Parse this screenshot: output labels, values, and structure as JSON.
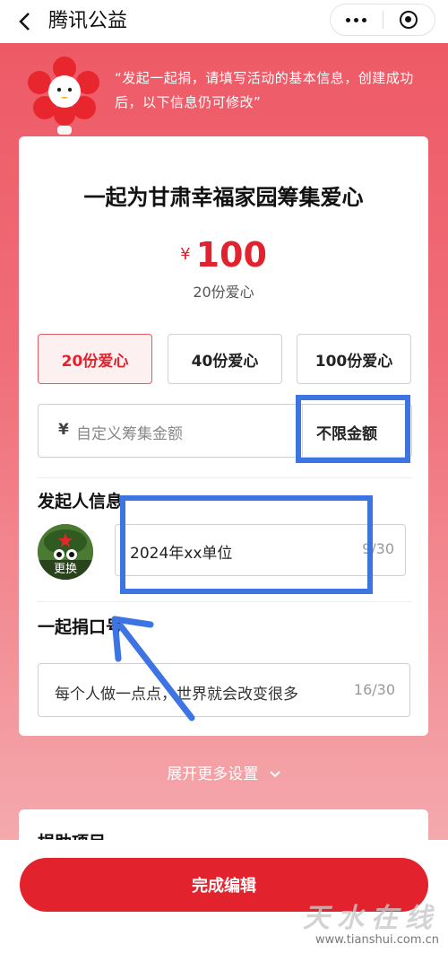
{
  "header": {
    "title": "腾讯公益",
    "back_icon": "chevron-left-icon",
    "more_icon": "more-dots-icon",
    "close_icon": "target-close-icon"
  },
  "intro": {
    "text": "“发起一起捐，请填写活动的基本信息，创建成功后，以下信息仍可修改”"
  },
  "project": {
    "title": "一起为甘肃幸福家园筹集爱心",
    "currency": "¥",
    "amount": "100",
    "amount_desc": "20份爱心"
  },
  "options": [
    {
      "label": "20份爱心",
      "selected": true
    },
    {
      "label": "40份爱心",
      "selected": false
    },
    {
      "label": "100份爱心",
      "selected": false
    }
  ],
  "custom_amount": {
    "currency": "¥",
    "placeholder": "自定义筹集金额",
    "unlimited_label": "不限金额"
  },
  "initiator": {
    "section_title": "发起人信息",
    "avatar_change_label": "更换",
    "name_value": "2024年xx单位",
    "name_count": "9/30"
  },
  "slogan": {
    "section_title": "一起捐口号",
    "value": "每个人做一点点，世界就会改变很多",
    "count": "16/30"
  },
  "expand": {
    "label": "展开更多设置"
  },
  "next_section": {
    "title": "捐助项目"
  },
  "footer": {
    "done_label": "完成编辑"
  },
  "watermark": {
    "brand": "天水在线",
    "url": "www.tianshui.com.cn"
  },
  "colors": {
    "accent": "#e2222d",
    "banner": "#ed5a66",
    "highlight": "#3d74e3"
  }
}
